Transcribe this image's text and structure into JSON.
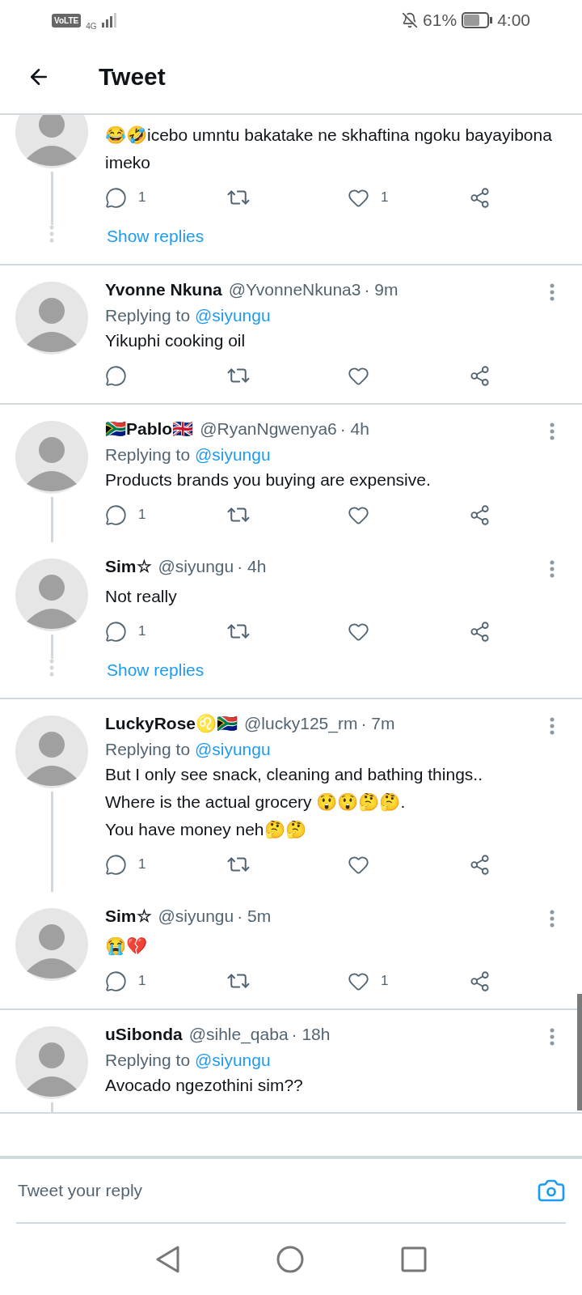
{
  "status_bar": {
    "volte": "VoLTE",
    "network": "4G",
    "battery": "61%",
    "time": "4:00"
  },
  "header": {
    "title": "Tweet"
  },
  "threads": [
    {
      "tweets": [
        {
          "cut_top": true,
          "text": "😂🤣icebo umntu bakatake ne skhaftina ngoku bayayibona imeko",
          "replies": "1",
          "likes": "1",
          "thread_line": true
        }
      ],
      "show_replies": "Show replies"
    },
    {
      "tweets": [
        {
          "name": "Yvonne Nkuna",
          "handle": "@YvonneNkuna3",
          "time": "· 9m",
          "replying_label": "Replying to",
          "replying_to": "@siyungu",
          "text": "Yikuphi cooking oil",
          "thread_line": false
        }
      ]
    },
    {
      "tweets": [
        {
          "name": "🇿🇦Pablo🇬🇧",
          "handle": "@RyanNgwenya6",
          "time": "· 4h",
          "replying_label": "Replying to",
          "replying_to": "@siyungu",
          "text": "Products brands you buying are expensive.",
          "replies": "1",
          "thread_line": true
        },
        {
          "name": "Sim☆",
          "handle": "@siyungu",
          "time": "· 4h",
          "text": "Not really",
          "replies": "1",
          "thread_line": true
        }
      ],
      "show_replies": "Show replies"
    },
    {
      "tweets": [
        {
          "name": "LuckyRose♌🇿🇦",
          "handle": "@lucky125_rm",
          "time": "· 7m",
          "replying_label": "Replying to",
          "replying_to": "@siyungu",
          "text": "But I only see snack, cleaning and bathing things..\nWhere is the actual grocery 😲😲🤔🤔.\nYou have money neh🤔🤔",
          "replies": "1",
          "thread_line": true
        },
        {
          "name": "Sim☆",
          "handle": "@siyungu",
          "time": "· 5m",
          "text": "😭💔",
          "replies": "1",
          "likes": "1",
          "thread_line": false
        }
      ]
    },
    {
      "tweets": [
        {
          "name": "uSibonda",
          "handle": "@sihle_qaba",
          "time": "· 18h",
          "replying_label": "Replying to",
          "replying_to": "@siyungu",
          "text": "Avocado ngezothini sim??",
          "thread_line": true,
          "no_actions": true
        }
      ]
    }
  ],
  "reply_bar": {
    "placeholder": "Tweet your reply"
  }
}
